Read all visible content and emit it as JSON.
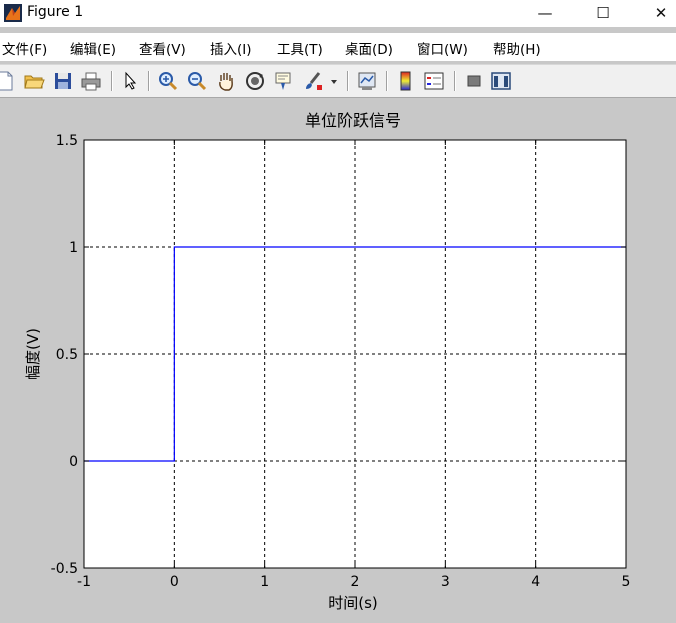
{
  "window": {
    "title": "Figure 1",
    "minimize_glyph": "—",
    "maximize_glyph": "☐",
    "close_glyph": "✕"
  },
  "menu": [
    {
      "label": "文件(F)"
    },
    {
      "label": "编辑(E)"
    },
    {
      "label": "查看(V)"
    },
    {
      "label": "插入(I)"
    },
    {
      "label": "工具(T)"
    },
    {
      "label": "桌面(D)"
    },
    {
      "label": "窗口(W)"
    },
    {
      "label": "帮助(H)"
    }
  ],
  "toolbar": {
    "icons": [
      "new-file-icon",
      "open-folder-icon",
      "save-icon",
      "print-icon",
      "pointer-icon",
      "zoom-in-icon",
      "zoom-out-icon",
      "pan-hand-icon",
      "rotate-3d-icon",
      "data-cursor-icon",
      "brush-icon",
      "dropdown-arrow-icon",
      "link-plot-icon",
      "colorbar-icon",
      "legend-icon",
      "hide-plot-tools-icon",
      "show-plot-tools-icon"
    ]
  },
  "colors": {
    "figure_bg": "#c8c8c8",
    "axes_bg": "#ffffff",
    "line": "#0000ff",
    "grid": "#000000"
  },
  "chart_data": {
    "type": "line",
    "title": "单位阶跃信号",
    "xlabel": "时间(s)",
    "ylabel": "幅度(V)",
    "xlim": [
      -1,
      5
    ],
    "ylim": [
      -0.5,
      1.5
    ],
    "xticks": [
      -1,
      0,
      1,
      2,
      3,
      4,
      5
    ],
    "yticks": [
      -0.5,
      0,
      0.5,
      1,
      1.5
    ],
    "xtick_labels": [
      "-1",
      "0",
      "1",
      "2",
      "3",
      "4",
      "5"
    ],
    "ytick_labels": [
      "-0.5",
      "0",
      "0.5",
      "1",
      "1.5"
    ],
    "grid": true,
    "series": [
      {
        "x": [
          -1,
          0,
          0,
          5
        ],
        "y": [
          0,
          0,
          1,
          1
        ]
      }
    ]
  }
}
